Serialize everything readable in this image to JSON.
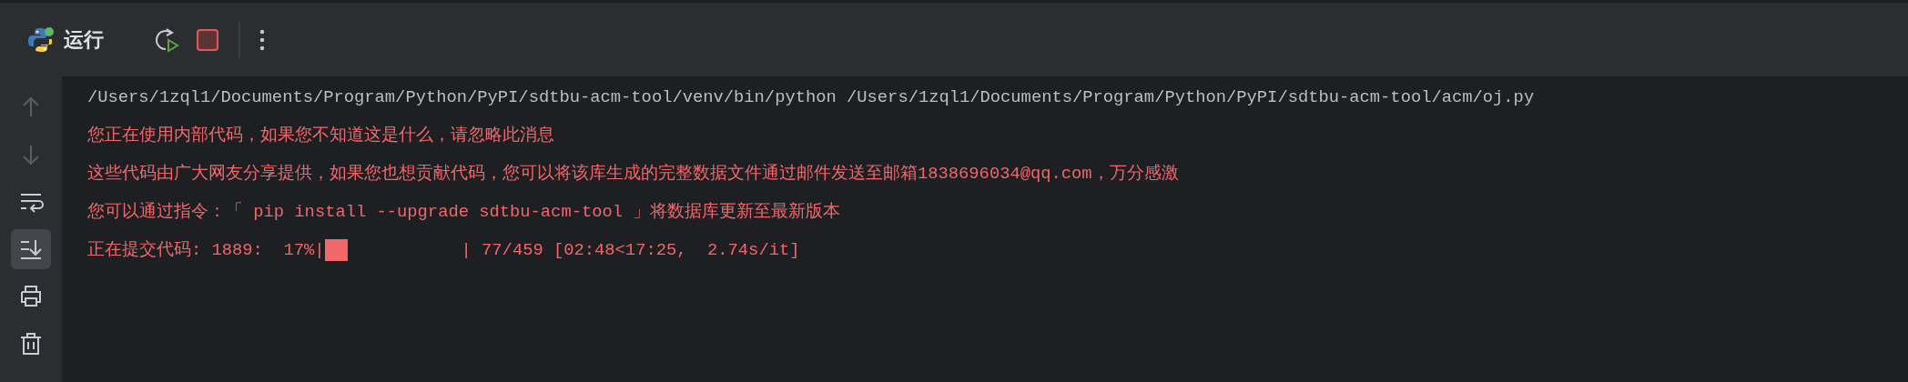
{
  "toolbar": {
    "title": "运行",
    "buttons": [
      {
        "kind": "rerun"
      },
      {
        "kind": "stop"
      },
      {
        "kind": "divider"
      },
      {
        "kind": "more"
      }
    ]
  },
  "sidebar": {
    "buttons": [
      {
        "kind": "up",
        "disabled": true,
        "selected": false
      },
      {
        "kind": "down",
        "disabled": true,
        "selected": false
      },
      {
        "kind": "wrap",
        "disabled": false,
        "selected": false
      },
      {
        "kind": "scroll-end",
        "disabled": false,
        "selected": true
      },
      {
        "kind": "print",
        "disabled": false,
        "selected": false
      },
      {
        "kind": "trash",
        "disabled": false,
        "selected": false
      }
    ]
  },
  "output": {
    "lines": [
      {
        "kind": "stdout",
        "text": "/Users/1zql1/Documents/Program/Python/PyPI/sdtbu-acm-tool/venv/bin/python /Users/1zql1/Documents/Program/Python/PyPI/sdtbu-acm-tool/acm/oj.py"
      },
      {
        "kind": "stderr",
        "text": "您正在使用内部代码，如果您不知道这是什么，请忽略此消息"
      },
      {
        "kind": "stderr",
        "text": "这些代码由广大网友分享提供，如果您也想贡献代码，您可以将该库生成的完整数据文件通过邮件发送至邮箱1838696034@qq.com，万分感激"
      },
      {
        "kind": "stderr",
        "text": "您可以通过指令：「 pip install --upgrade sdtbu-acm-tool 」将数据库更新至最新版本"
      },
      {
        "kind": "progress",
        "prefix": "正在提交代码: 1889:  17%|",
        "level": 0.17,
        "suffix": "| 77/459 [02:48<17:25,  2.74s/it]"
      }
    ]
  }
}
